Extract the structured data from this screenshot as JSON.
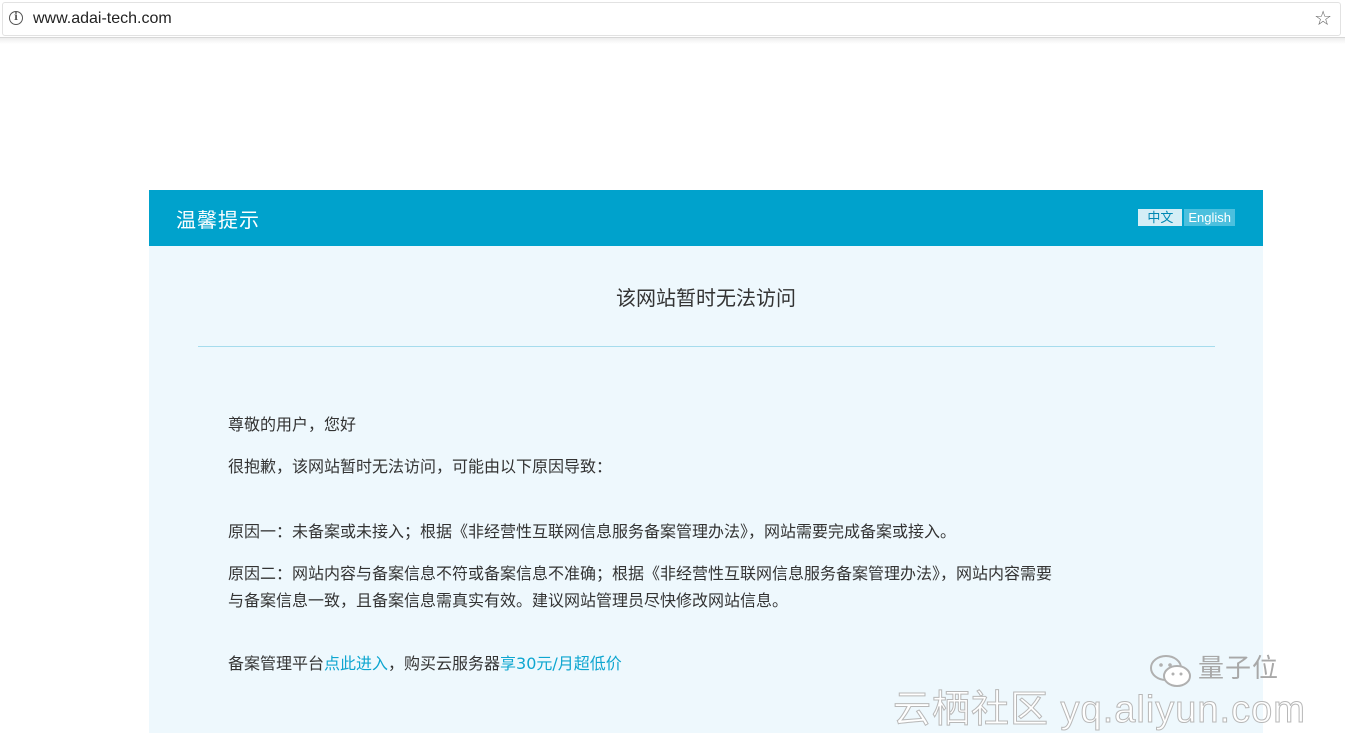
{
  "browser": {
    "url": "www.adai-tech.com",
    "info_glyph": "i",
    "star_glyph": "☆"
  },
  "panel": {
    "title": "温馨提示",
    "lang": {
      "zh": "中文",
      "en": "English"
    },
    "heading": "该网站暂时无法访问",
    "greeting": "尊敬的用户，您好",
    "apology": "很抱歉，该网站暂时无法访问，可能由以下原因导致：",
    "reason1": "原因一：未备案或未接入；根据《非经营性互联网信息服务备案管理办法》，网站需要完成备案或接入。",
    "reason2_line1": "原因二：网站内容与备案信息不符或备案信息不准确；根据《非经营性互联网信息服务备案管理办法》，网站内容需要",
    "reason2_line2": "与备案信息一致，且备案信息需真实有效。建议网站管理员尽快修改网站信息。",
    "footer_prefix": "备案管理平台",
    "footer_link1": "点此进入",
    "footer_middle": "，购买云服务器",
    "footer_link2": "享30元/月超低价"
  },
  "watermark": {
    "brand": "量子位",
    "site": "云栖社区 yq.aliyun.com"
  },
  "colors": {
    "header": "#00a2cc",
    "panel_bg": "#eef8fd",
    "link": "#0ea6d0",
    "divider": "#a6dced"
  }
}
